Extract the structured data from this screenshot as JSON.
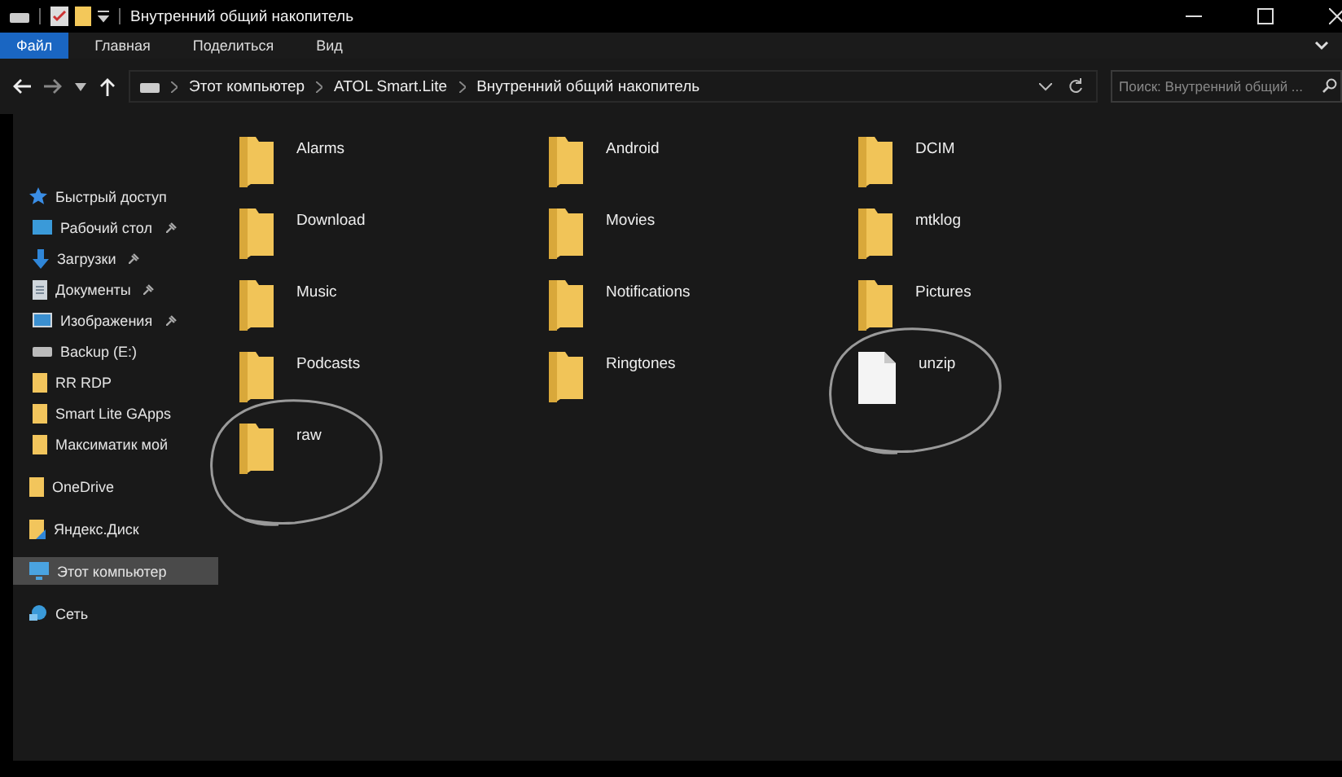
{
  "window": {
    "title": "Внутренний общий накопитель"
  },
  "ribbon_tabs": [
    {
      "label": "Файл",
      "selected": true
    },
    {
      "label": "Главная",
      "selected": false
    },
    {
      "label": "Поделиться",
      "selected": false
    },
    {
      "label": "Вид",
      "selected": false
    }
  ],
  "address_bar": {
    "path": [
      "Этот компьютер",
      "ATOL Smart.Lite",
      "Внутренний общий накопитель"
    ]
  },
  "search": {
    "placeholder": "Поиск: Внутренний общий ..."
  },
  "sidebar": {
    "items": [
      {
        "label": "Быстрый доступ",
        "kind": "star",
        "selected": false,
        "children": [
          {
            "label": "Рабочий стол",
            "kind": "desktop",
            "pinned": true,
            "selected": false
          },
          {
            "label": "Загрузки",
            "kind": "download",
            "pinned": true,
            "selected": false
          },
          {
            "label": "Документы",
            "kind": "document",
            "pinned": true,
            "selected": false
          },
          {
            "label": "Изображения",
            "kind": "image",
            "pinned": true,
            "selected": false
          },
          {
            "label": "Backup (E:)",
            "kind": "drive",
            "pinned": false,
            "selected": false
          },
          {
            "label": "RR RDP",
            "kind": "folder",
            "pinned": false,
            "selected": false
          },
          {
            "label": "Smart Lite GApps",
            "kind": "folder",
            "pinned": false,
            "selected": false
          },
          {
            "label": "Максиматик мой",
            "kind": "folder",
            "pinned": false,
            "selected": false
          }
        ]
      },
      {
        "label": "OneDrive",
        "kind": "folder",
        "selected": false
      },
      {
        "label": "Яндекс.Диск",
        "kind": "cloud",
        "selected": false
      },
      {
        "label": "Этот компьютер",
        "kind": "computer",
        "selected": true
      },
      {
        "label": "Сеть",
        "kind": "network",
        "selected": false
      }
    ]
  },
  "files": [
    {
      "name": "Alarms",
      "kind": "folder",
      "circled": false
    },
    {
      "name": "Android",
      "kind": "folder",
      "circled": false
    },
    {
      "name": "DCIM",
      "kind": "folder",
      "circled": false
    },
    {
      "name": "Download",
      "kind": "folder",
      "circled": false
    },
    {
      "name": "Movies",
      "kind": "folder",
      "circled": false
    },
    {
      "name": "mtklog",
      "kind": "folder",
      "circled": false
    },
    {
      "name": "Music",
      "kind": "folder",
      "circled": false
    },
    {
      "name": "Notifications",
      "kind": "folder",
      "circled": false
    },
    {
      "name": "Pictures",
      "kind": "folder",
      "circled": false
    },
    {
      "name": "Podcasts",
      "kind": "folder",
      "circled": false
    },
    {
      "name": "Ringtones",
      "kind": "folder",
      "circled": false
    },
    {
      "name": "unzip",
      "kind": "file",
      "circled": true
    },
    {
      "name": "raw",
      "kind": "folder",
      "circled": true
    }
  ]
}
